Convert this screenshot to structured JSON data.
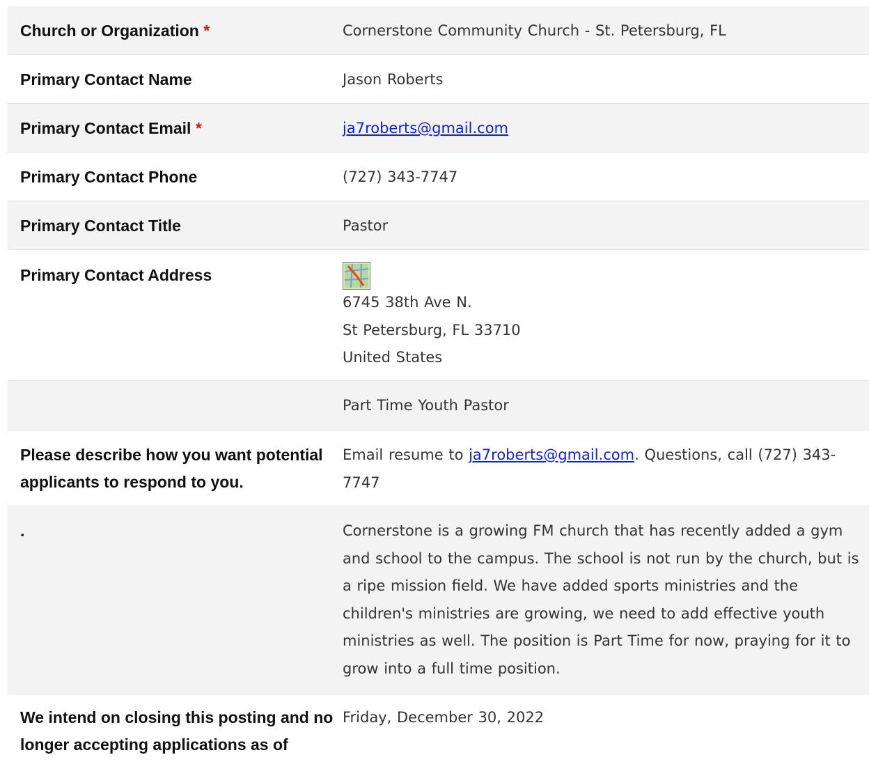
{
  "fields": {
    "organization": {
      "label": "Church or Organization",
      "required_mark": "*",
      "value": "Cornerstone Community Church - St. Petersburg, FL"
    },
    "contact_name": {
      "label": "Primary Contact Name",
      "value": "Jason Roberts"
    },
    "contact_email": {
      "label": "Primary Contact Email",
      "required_mark": "*",
      "value": "ja7roberts@gmail.com"
    },
    "contact_phone": {
      "label": "Primary Contact Phone",
      "value": "(727) 343-7747"
    },
    "contact_title": {
      "label": "Primary Contact Title",
      "value": "Pastor"
    },
    "contact_address": {
      "label": "Primary Contact Address",
      "map_icon": "map-icon",
      "lines": [
        "6745 38th Ave N.",
        "St Petersburg, FL 33710",
        "United States"
      ]
    },
    "position": {
      "label": "",
      "value": "Part Time Youth Pastor"
    },
    "respond": {
      "label": "Please describe how you want potential applicants to respond to you.",
      "prefix": "Email resume to ",
      "email": "ja7roberts@gmail.com",
      "suffix": ". Questions, call (727) 343-7747"
    },
    "description": {
      "label": ".",
      "value": "Cornerstone is a growing FM church that has recently added a gym and school to the campus. The school is not run by the church, but is a ripe mission field. We have added sports ministries and the children's ministries are growing, we need to add effective youth ministries as well. The position is Part Time for now, praying for it to grow into a full time position."
    },
    "closing": {
      "label": "We intend on closing this posting and no longer accepting applications as of",
      "value": "Friday, December 30, 2022"
    }
  },
  "colors": {
    "required": "#e0140e",
    "link": "#0b1fe6",
    "shaded_row": "#f3f3f3"
  }
}
